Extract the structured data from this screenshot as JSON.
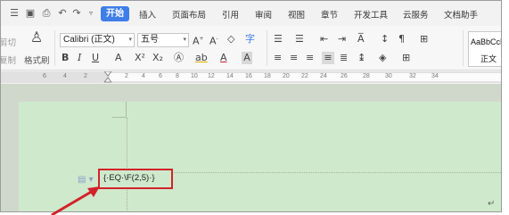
{
  "tabs": {
    "active": "开始",
    "items": [
      "插入",
      "页面布局",
      "引用",
      "审阅",
      "视图",
      "章节",
      "开发工具",
      "云服务",
      "文档助手"
    ]
  },
  "quick_access": {
    "icons": [
      "menu-icon",
      "save-icon",
      "print-icon",
      "undo-icon",
      "redo-icon",
      "customize-dropdown-icon"
    ]
  },
  "ribbon": {
    "cut_label": "剪切",
    "copy_label": "复制",
    "format_painter_label": "格式刷",
    "font_name": "Calibri (正文)",
    "font_size": "五号",
    "style_sample": "AaBbCcDd",
    "style_name": "正文"
  },
  "ruler": {
    "ticks": [
      "6",
      "4",
      "2",
      "2",
      "4",
      "6",
      "8",
      "10",
      "12",
      "14",
      "16",
      "18",
      "20",
      "22",
      "24",
      "26",
      "28",
      "30",
      "32",
      "34"
    ]
  },
  "document": {
    "field_code": "{·EQ·\\F(2,5)·}",
    "paragraph_mark": "↵"
  },
  "colors": {
    "accent": "#3f7ee8",
    "page_background": "#cfe9cc",
    "highlight": "#d2232a"
  }
}
